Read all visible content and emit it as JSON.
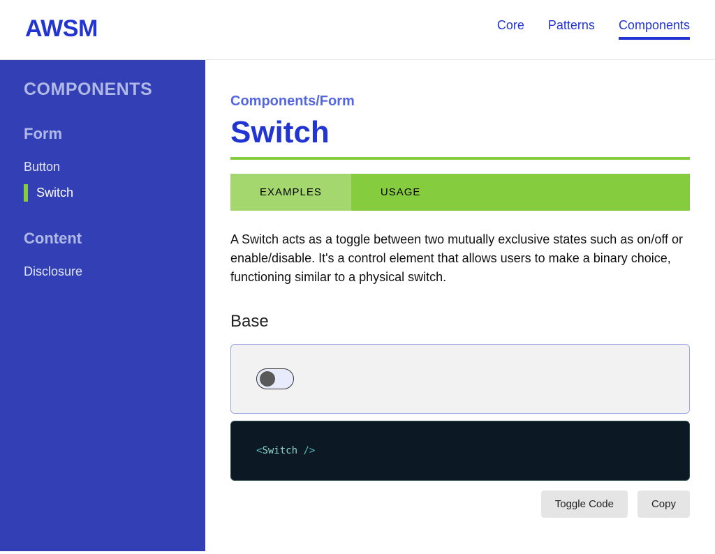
{
  "header": {
    "logo": "AWSM",
    "nav": {
      "core": "Core",
      "patterns": "Patterns",
      "components": "Components"
    }
  },
  "sidebar": {
    "title": "COMPONENTS",
    "groups": [
      {
        "title": "Form",
        "items": [
          {
            "label": "Button"
          },
          {
            "label": "Switch"
          }
        ]
      },
      {
        "title": "Content",
        "items": [
          {
            "label": "Disclosure"
          }
        ]
      }
    ]
  },
  "main": {
    "breadcrumb": "Components/Form",
    "title": "Switch",
    "tabs": {
      "examples": "EXAMPLES",
      "usage": "USAGE"
    },
    "description": "A Switch acts as a toggle between two mutually exclusive states such as on/off or enable/disable. It's a control element that allows users to make a binary choice, functioning similar to a physical switch.",
    "section_heading": "Base",
    "code": {
      "open": "<",
      "tag": "Switch",
      "close": " />"
    },
    "actions": {
      "toggle_code": "Toggle Code",
      "copy": "Copy"
    }
  }
}
